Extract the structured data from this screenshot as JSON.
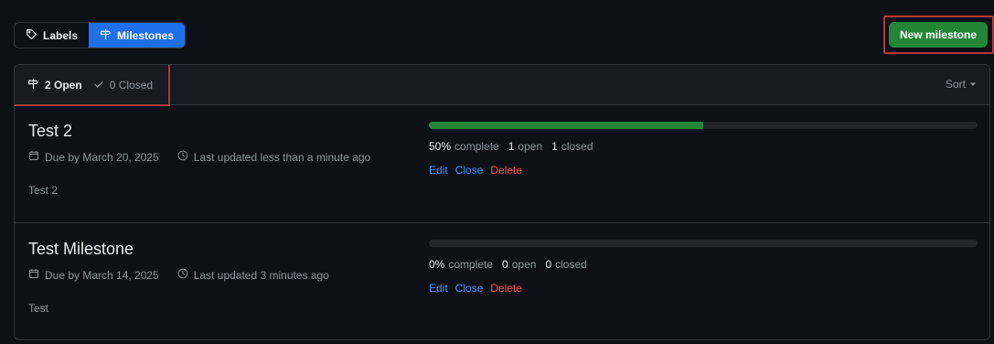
{
  "topbar": {
    "tabs": [
      {
        "label": "Labels",
        "icon": "tag-icon",
        "active": false
      },
      {
        "label": "Milestones",
        "icon": "milestone-icon",
        "active": true
      }
    ],
    "new_button": "New milestone"
  },
  "list": {
    "header": {
      "open_label": "2 Open",
      "closed_label": "0 Closed",
      "sort_label": "Sort"
    },
    "milestones": [
      {
        "title": "Test 2",
        "due": "Due by March 20, 2025",
        "updated": "Last updated less than a minute ago",
        "description": "Test 2",
        "progress": 0.5,
        "percent_label": "50%",
        "complete_text": "complete",
        "open_count": "1",
        "open_text": "open",
        "closed_count": "1",
        "closed_text": "closed",
        "actions": {
          "edit": "Edit",
          "close": "Close",
          "delete": "Delete"
        }
      },
      {
        "title": "Test Milestone",
        "due": "Due by March 14, 2025",
        "updated": "Last updated 3 minutes ago",
        "description": "Test",
        "progress": 0,
        "percent_label": "0%",
        "complete_text": "complete",
        "open_count": "0",
        "open_text": "open",
        "closed_count": "0",
        "closed_text": "closed",
        "actions": {
          "edit": "Edit",
          "close": "Close",
          "delete": "Delete"
        }
      }
    ]
  },
  "colors": {
    "accent_blue": "#1f6feb",
    "success_green": "#238636",
    "danger_red": "#f85149",
    "highlight_red": "#b03a3a"
  }
}
